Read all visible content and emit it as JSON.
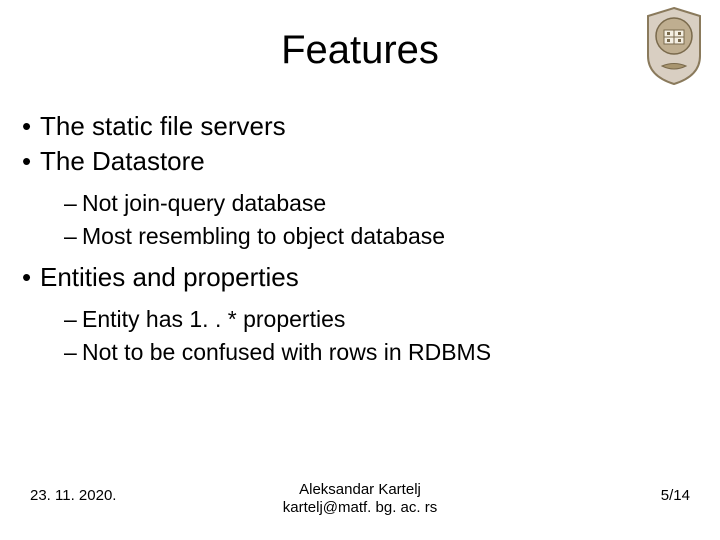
{
  "title": "Features",
  "bullets": {
    "b1": "The static file servers",
    "b2": "The Datastore",
    "b2s1": "Not join-query database",
    "b2s2": "Most resembling to object database",
    "b3": "Entities and properties",
    "b3s1": "Entity has 1. . * properties",
    "b3s2": "Not to be confused with rows in RDBMS"
  },
  "footer": {
    "date": "23. 11. 2020.",
    "author": "Aleksandar Kartelj",
    "email": "kartelj@matf. bg. ac. rs",
    "page": "5/14"
  },
  "logo": {
    "name": "university-seal"
  }
}
